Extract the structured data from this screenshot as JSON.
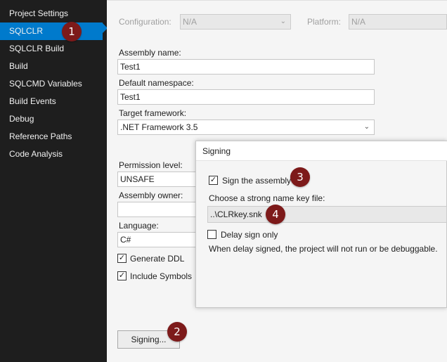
{
  "sidebar": {
    "items": [
      {
        "label": "Project Settings",
        "active": false
      },
      {
        "label": "SQLCLR",
        "active": true
      },
      {
        "label": "SQLCLR Build",
        "active": false
      },
      {
        "label": "Build",
        "active": false
      },
      {
        "label": "SQLCMD Variables",
        "active": false
      },
      {
        "label": "Build Events",
        "active": false
      },
      {
        "label": "Debug",
        "active": false
      },
      {
        "label": "Reference Paths",
        "active": false
      },
      {
        "label": "Code Analysis",
        "active": false
      }
    ]
  },
  "header": {
    "configuration_label": "Configuration:",
    "configuration_value": "N/A",
    "platform_label": "Platform:",
    "platform_value": "N/A"
  },
  "form": {
    "assembly_name_label": "Assembly name:",
    "assembly_name_value": "Test1",
    "default_namespace_label": "Default namespace:",
    "default_namespace_value": "Test1",
    "target_framework_label": "Target framework:",
    "target_framework_value": ".NET Framework 3.5",
    "permission_level_label": "Permission level:",
    "permission_level_value": "UNSAFE",
    "assembly_owner_label": "Assembly owner:",
    "assembly_owner_value": "",
    "language_label": "Language:",
    "language_value": "C#",
    "generate_ddl_label": "Generate DDL",
    "generate_ddl_checked": true,
    "include_symbols_label": "Include Symbols",
    "include_symbols_checked": true,
    "signing_button_label": "Signing..."
  },
  "signing_dialog": {
    "title": "Signing",
    "sign_assembly_label": "Sign the assembly",
    "sign_assembly_checked": true,
    "key_file_label": "Choose a strong name key file:",
    "key_file_value": "..\\CLRkey.snk",
    "delay_sign_label": "Delay sign only",
    "delay_sign_checked": false,
    "delay_sign_note": "When delay signed, the project will not run or be debuggable."
  },
  "callouts": [
    "1",
    "2",
    "3",
    "4"
  ],
  "colors": {
    "sidebar_bg": "#1e1e1e",
    "accent": "#007acc",
    "callout": "#7d1a1a"
  },
  "icons": {
    "check": "checkmark-icon",
    "dropdown": "chevron-down-icon"
  }
}
